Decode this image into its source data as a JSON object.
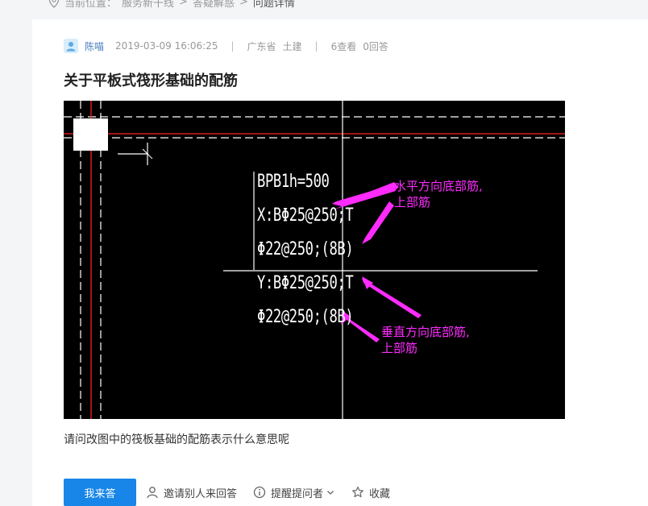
{
  "breadcrumb": {
    "label": "当前位置：",
    "items": [
      "服务新干线",
      "答疑解惑"
    ],
    "separator": ">",
    "current": "问题详情"
  },
  "question": {
    "author": "陈喵",
    "datetime": "2019-03-09 16:06:25",
    "meta_separator": "|",
    "province": "广东省",
    "category": "土建",
    "views": "6查看",
    "answers": "0回答",
    "title": "关于平板式筏形基础的配筋",
    "body": "请问改图中的筏板基础的配筋表示什么意思呢"
  },
  "image": {
    "background": "#000000",
    "annotation_color": "#ff2bff",
    "cad_text": [
      "BPB1h=500",
      "X:BΦ25@250;T",
      "Φ22@250;(8B)",
      "Y:BΦ25@250;T",
      "Φ22@250;(8B)"
    ],
    "annotation_horizontal": [
      "水平方向底部筋,",
      "上部筋"
    ],
    "annotation_vertical": [
      "垂直方向底部筋,",
      "上部筋"
    ]
  },
  "actions": {
    "answer_button": "我来答",
    "invite": "邀请别人来回答",
    "remind": "提醒提问者",
    "favorite": "收藏"
  },
  "colors": {
    "primary": "#1786e8",
    "author_link": "#4a7fc1"
  }
}
